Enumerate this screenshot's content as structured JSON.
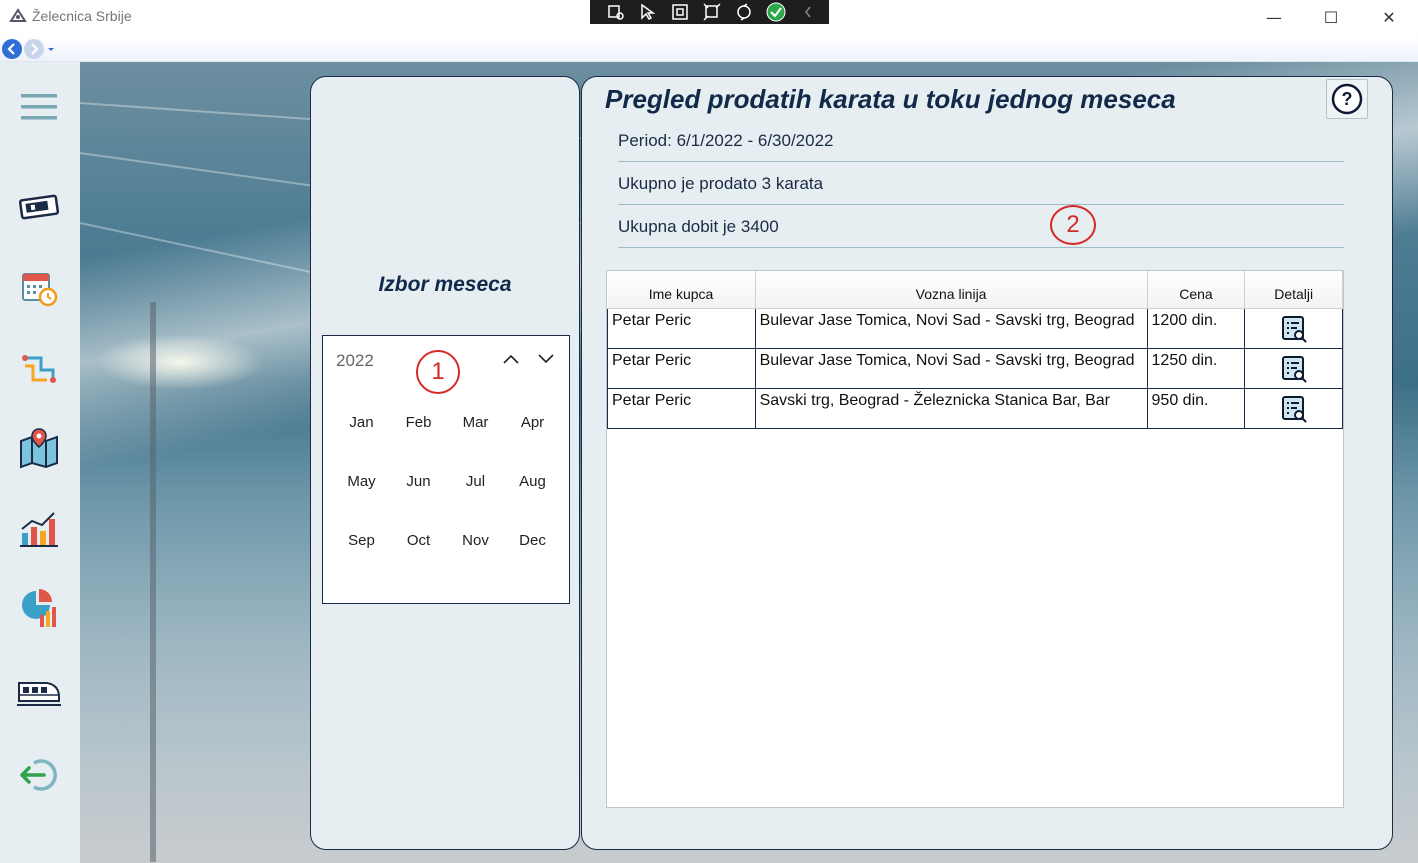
{
  "window": {
    "title": "Želecnica Srbije",
    "minimize_label": "—",
    "maximize_label": "☐",
    "close_label": "✕"
  },
  "sidebar": {
    "items": [
      {
        "icon": "hamburger-menu-icon"
      },
      {
        "icon": "ticket-icon"
      },
      {
        "icon": "calendar-clock-icon"
      },
      {
        "icon": "route-icon"
      },
      {
        "icon": "map-pin-icon"
      },
      {
        "icon": "bar-chart-icon"
      },
      {
        "icon": "pie-chart-report-icon"
      },
      {
        "icon": "train-icon"
      },
      {
        "icon": "logout-icon"
      }
    ]
  },
  "month_picker": {
    "title": "Izbor meseca",
    "year": "2022",
    "months": [
      "Jan",
      "Feb",
      "Mar",
      "Apr",
      "May",
      "Jun",
      "Jul",
      "Aug",
      "Sep",
      "Oct",
      "Nov",
      "Dec"
    ],
    "annotation": "1"
  },
  "report": {
    "title": "Pregled prodatih karata u toku jednog meseca",
    "help_label": "?",
    "period": "Period: 6/1/2022 - 6/30/2022",
    "total_sold": "Ukupno je prodato 3 karata",
    "total_profit": "Ukupna dobit je 3400",
    "annotation": "2"
  },
  "table": {
    "headers": [
      "Ime kupca",
      "Vozna linija",
      "Cena",
      "Detalji"
    ],
    "rows": [
      {
        "customer": "Petar Peric",
        "line": "Bulevar Jase Tomica, Novi Sad - Savski trg, Beograd",
        "price": "1200 din."
      },
      {
        "customer": "Petar Peric",
        "line": "Bulevar Jase Tomica, Novi Sad - Savski trg, Beograd",
        "price": "1250 din."
      },
      {
        "customer": "Petar Peric",
        "line": "Savski trg, Beograd - Železnicka Stanica Bar, Bar",
        "price": "950 din."
      }
    ]
  },
  "colors": {
    "panel_bg": "#e6eef1",
    "border_dark": "#1b2b45",
    "title_text": "#122a4a",
    "annotation_red": "#d42a2a"
  }
}
